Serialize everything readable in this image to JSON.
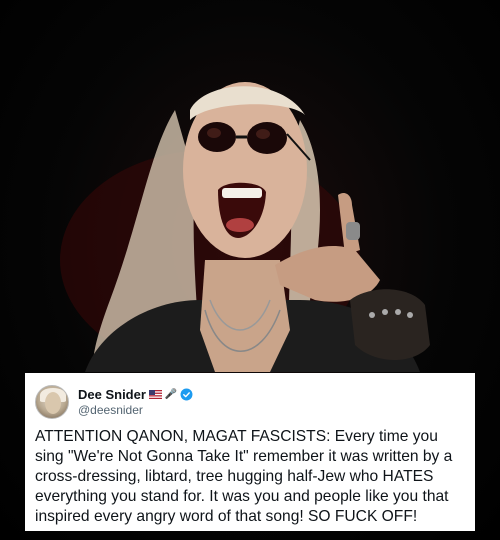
{
  "photo": {
    "icon": "dee-snider-photo"
  },
  "tweet": {
    "display_name": "Dee Snider",
    "handle": "@deesnider",
    "badges": [
      "us-flag-icon",
      "microphone-icon",
      "verified-badge-icon"
    ],
    "text": "ATTENTION QANON, MAGAT FASCISTS: Every time you sing \"We're Not Gonna Take It\" remember it was written by a cross-dressing, libtard, tree hugging half-Jew who HATES everything you stand for. It was you and people like you that inspired every angry word of that song! SO FUCK OFF!"
  },
  "colors": {
    "background": "#000000",
    "card": "#ffffff",
    "text": "#0f1419",
    "handle": "#536471",
    "verified": "#1d9bf0"
  }
}
